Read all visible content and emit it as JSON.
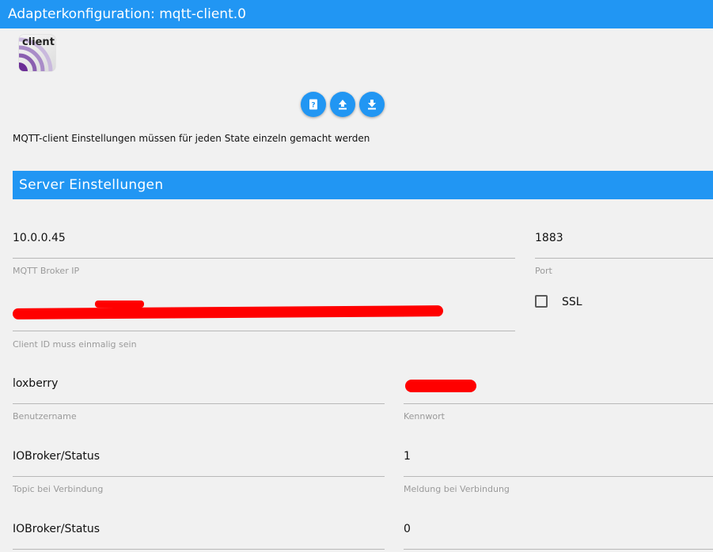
{
  "window": {
    "title": "Adapterkonfiguration: mqtt-client.0"
  },
  "logo": {
    "text": "client",
    "icon": "mqtt-client-logo"
  },
  "toolbar": {
    "buttons": [
      {
        "name": "help",
        "icon": "help-book-icon"
      },
      {
        "name": "upload",
        "icon": "upload-icon"
      },
      {
        "name": "download",
        "icon": "download-icon"
      }
    ]
  },
  "info": "MQTT-client Einstellungen müssen für jeden State einzeln gemacht werden",
  "section": {
    "title": "Server Einstellungen"
  },
  "fields": {
    "broker_ip": {
      "value": "10.0.0.45",
      "label": "MQTT Broker IP"
    },
    "port": {
      "value": "1883",
      "label": "Port"
    },
    "ssl": {
      "label": "SSL",
      "checked": false
    },
    "client_id": {
      "value": "",
      "label": "Client ID muss einmalig sein"
    },
    "username": {
      "value": "loxberry",
      "label": "Benutzername"
    },
    "password": {
      "value": "",
      "label": "Kennwort"
    },
    "connect_topic": {
      "value": "IOBroker/Status",
      "label": "Topic bei Verbindung"
    },
    "connect_message": {
      "value": "1",
      "label": "Meldung bei Verbindung"
    },
    "disconnect_topic": {
      "value": "IOBroker/Status"
    },
    "disconnect_message": {
      "value": "0"
    }
  },
  "colors": {
    "accent": "#2196f3",
    "redaction": "#ff0000",
    "background": "#f1f1f1"
  }
}
